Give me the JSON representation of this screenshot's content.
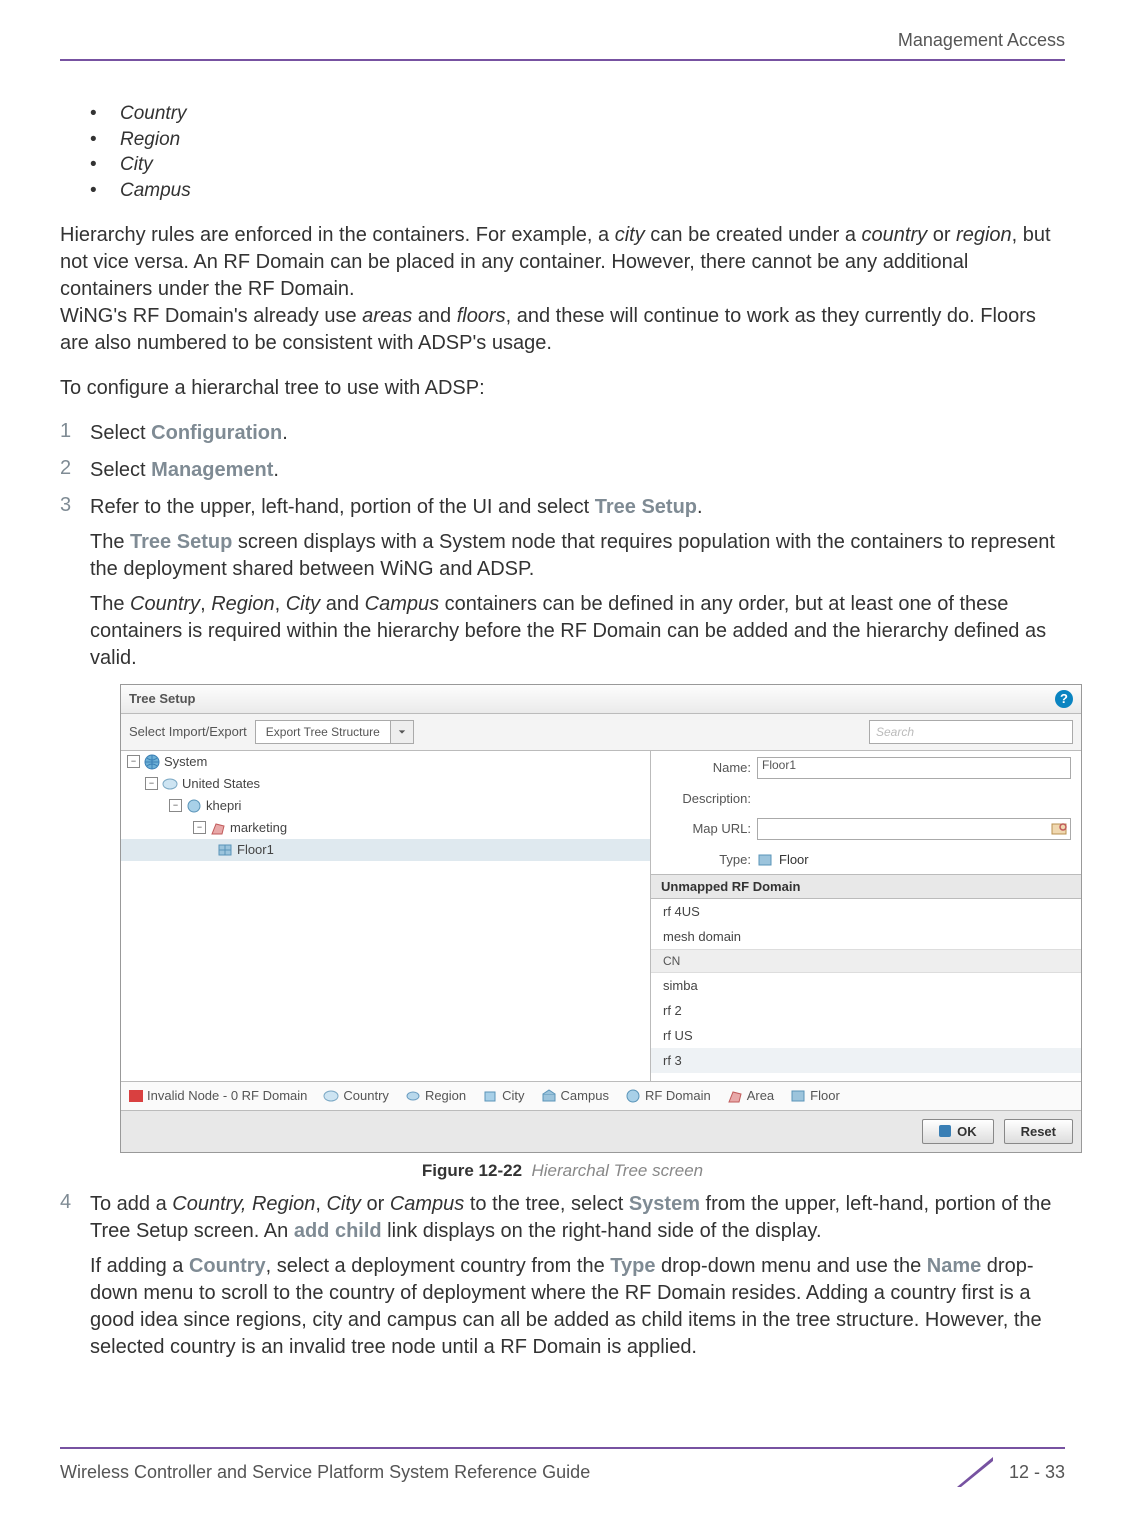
{
  "header": {
    "title": "Management Access"
  },
  "bullets": [
    "Country",
    "Region",
    "City",
    "Campus"
  ],
  "para1a": "Hierarchy rules are enforced in the containers. For example, a ",
  "para1b": " can be created under a ",
  "para1c": " or ",
  "para1d": ", but not vice versa. An RF Domain can be placed in any container. However, there cannot be any additional containers under the RF Domain.",
  "para1_city": "city",
  "para1_country": "country",
  "para1_region": "region",
  "para2a": "WiNG's RF Domain's already use ",
  "para2b": " and ",
  "para2c": ", and these will continue to work as they currently do. Floors are also numbered to be consistent with ADSP's usage.",
  "para2_areas": "areas",
  "para2_floors": "floors",
  "para3": "To configure a hierarchal tree to use with ADSP:",
  "step1": {
    "num": "1",
    "pre": "Select ",
    "kw": "Configuration",
    "post": "."
  },
  "step2": {
    "num": "2",
    "pre": "Select ",
    "kw": "Management",
    "post": "."
  },
  "step3": {
    "num": "3",
    "pre": "Refer to the upper, left-hand, portion of the UI and select ",
    "kw": "Tree Setup",
    "post": ".",
    "sub1a": "The ",
    "sub1kw": "Tree Setup",
    "sub1b": " screen displays with a System node that requires population with the containers to represent the deployment shared between WiNG and ADSP.",
    "sub2a": "The ",
    "sub2it1": "Country",
    "sub2c1": ", ",
    "sub2it2": "Region",
    "sub2c2": ", ",
    "sub2it3": "City",
    "sub2c3": " and ",
    "sub2it4": "Campus",
    "sub2b": " containers can be defined in any order, but at least one of these containers is required within the hierarchy before the RF Domain can be added and the hierarchy defined as valid."
  },
  "screenshot": {
    "title": "Tree Setup",
    "toolbar_label": "Select Import/Export",
    "combo_value": "Export Tree Structure",
    "search_placeholder": "Search",
    "tree": {
      "n0": "System",
      "n1": "United States",
      "n2": "khepri",
      "n3": "marketing",
      "n4": "Floor1"
    },
    "form": {
      "name_label": "Name:",
      "name_value": "Floor1",
      "desc_label": "Description:",
      "mapurl_label": "Map URL:",
      "type_label": "Type:",
      "type_value": "Floor"
    },
    "rf_header": "Unmapped RF Domain",
    "rf_items": {
      "i0": "rf 4US",
      "i1": "mesh domain"
    },
    "rf_group": "CN",
    "rf_items2": {
      "i0": "simba",
      "i1": "rf 2",
      "i2": "rf US",
      "i3": "rf 3"
    },
    "legend": {
      "i0": "Invalid Node - 0 RF Domain",
      "i1": "Country",
      "i2": "Region",
      "i3": "City",
      "i4": "Campus",
      "i5": "RF Domain",
      "i6": "Area",
      "i7": "Floor"
    },
    "buttons": {
      "ok": "OK",
      "reset": "Reset"
    }
  },
  "caption": {
    "label": "Figure 12-22",
    "desc": "Hierarchal Tree screen"
  },
  "step4": {
    "num": "4",
    "l1a": "To add a ",
    "l1it1": "Country, Region",
    "l1c1": ", ",
    "l1it2": "City",
    "l1c2": " or ",
    "l1it3": "Campus",
    "l1b": " to the tree, select ",
    "l1kw1": "System",
    "l1c": " from the upper, left-hand, portion of the Tree Setup screen. An ",
    "l1kw2": "add child",
    "l1d": " link displays on the right-hand side of the display.",
    "l2a": "If adding a ",
    "l2kw1": "Country",
    "l2b": ", select a deployment country from the ",
    "l2kw2": "Type",
    "l2c": " drop-down menu and use the ",
    "l2kw3": "Name",
    "l2d": " drop-down menu to scroll to the country of deployment where the RF Domain resides. Adding a country first is a good idea since regions, city and campus can all be added as child items in the tree structure. However, the selected country is an invalid tree node until a RF Domain is applied."
  },
  "footer": {
    "left": "Wireless Controller and Service Platform System Reference Guide",
    "right": "12 - 33"
  }
}
